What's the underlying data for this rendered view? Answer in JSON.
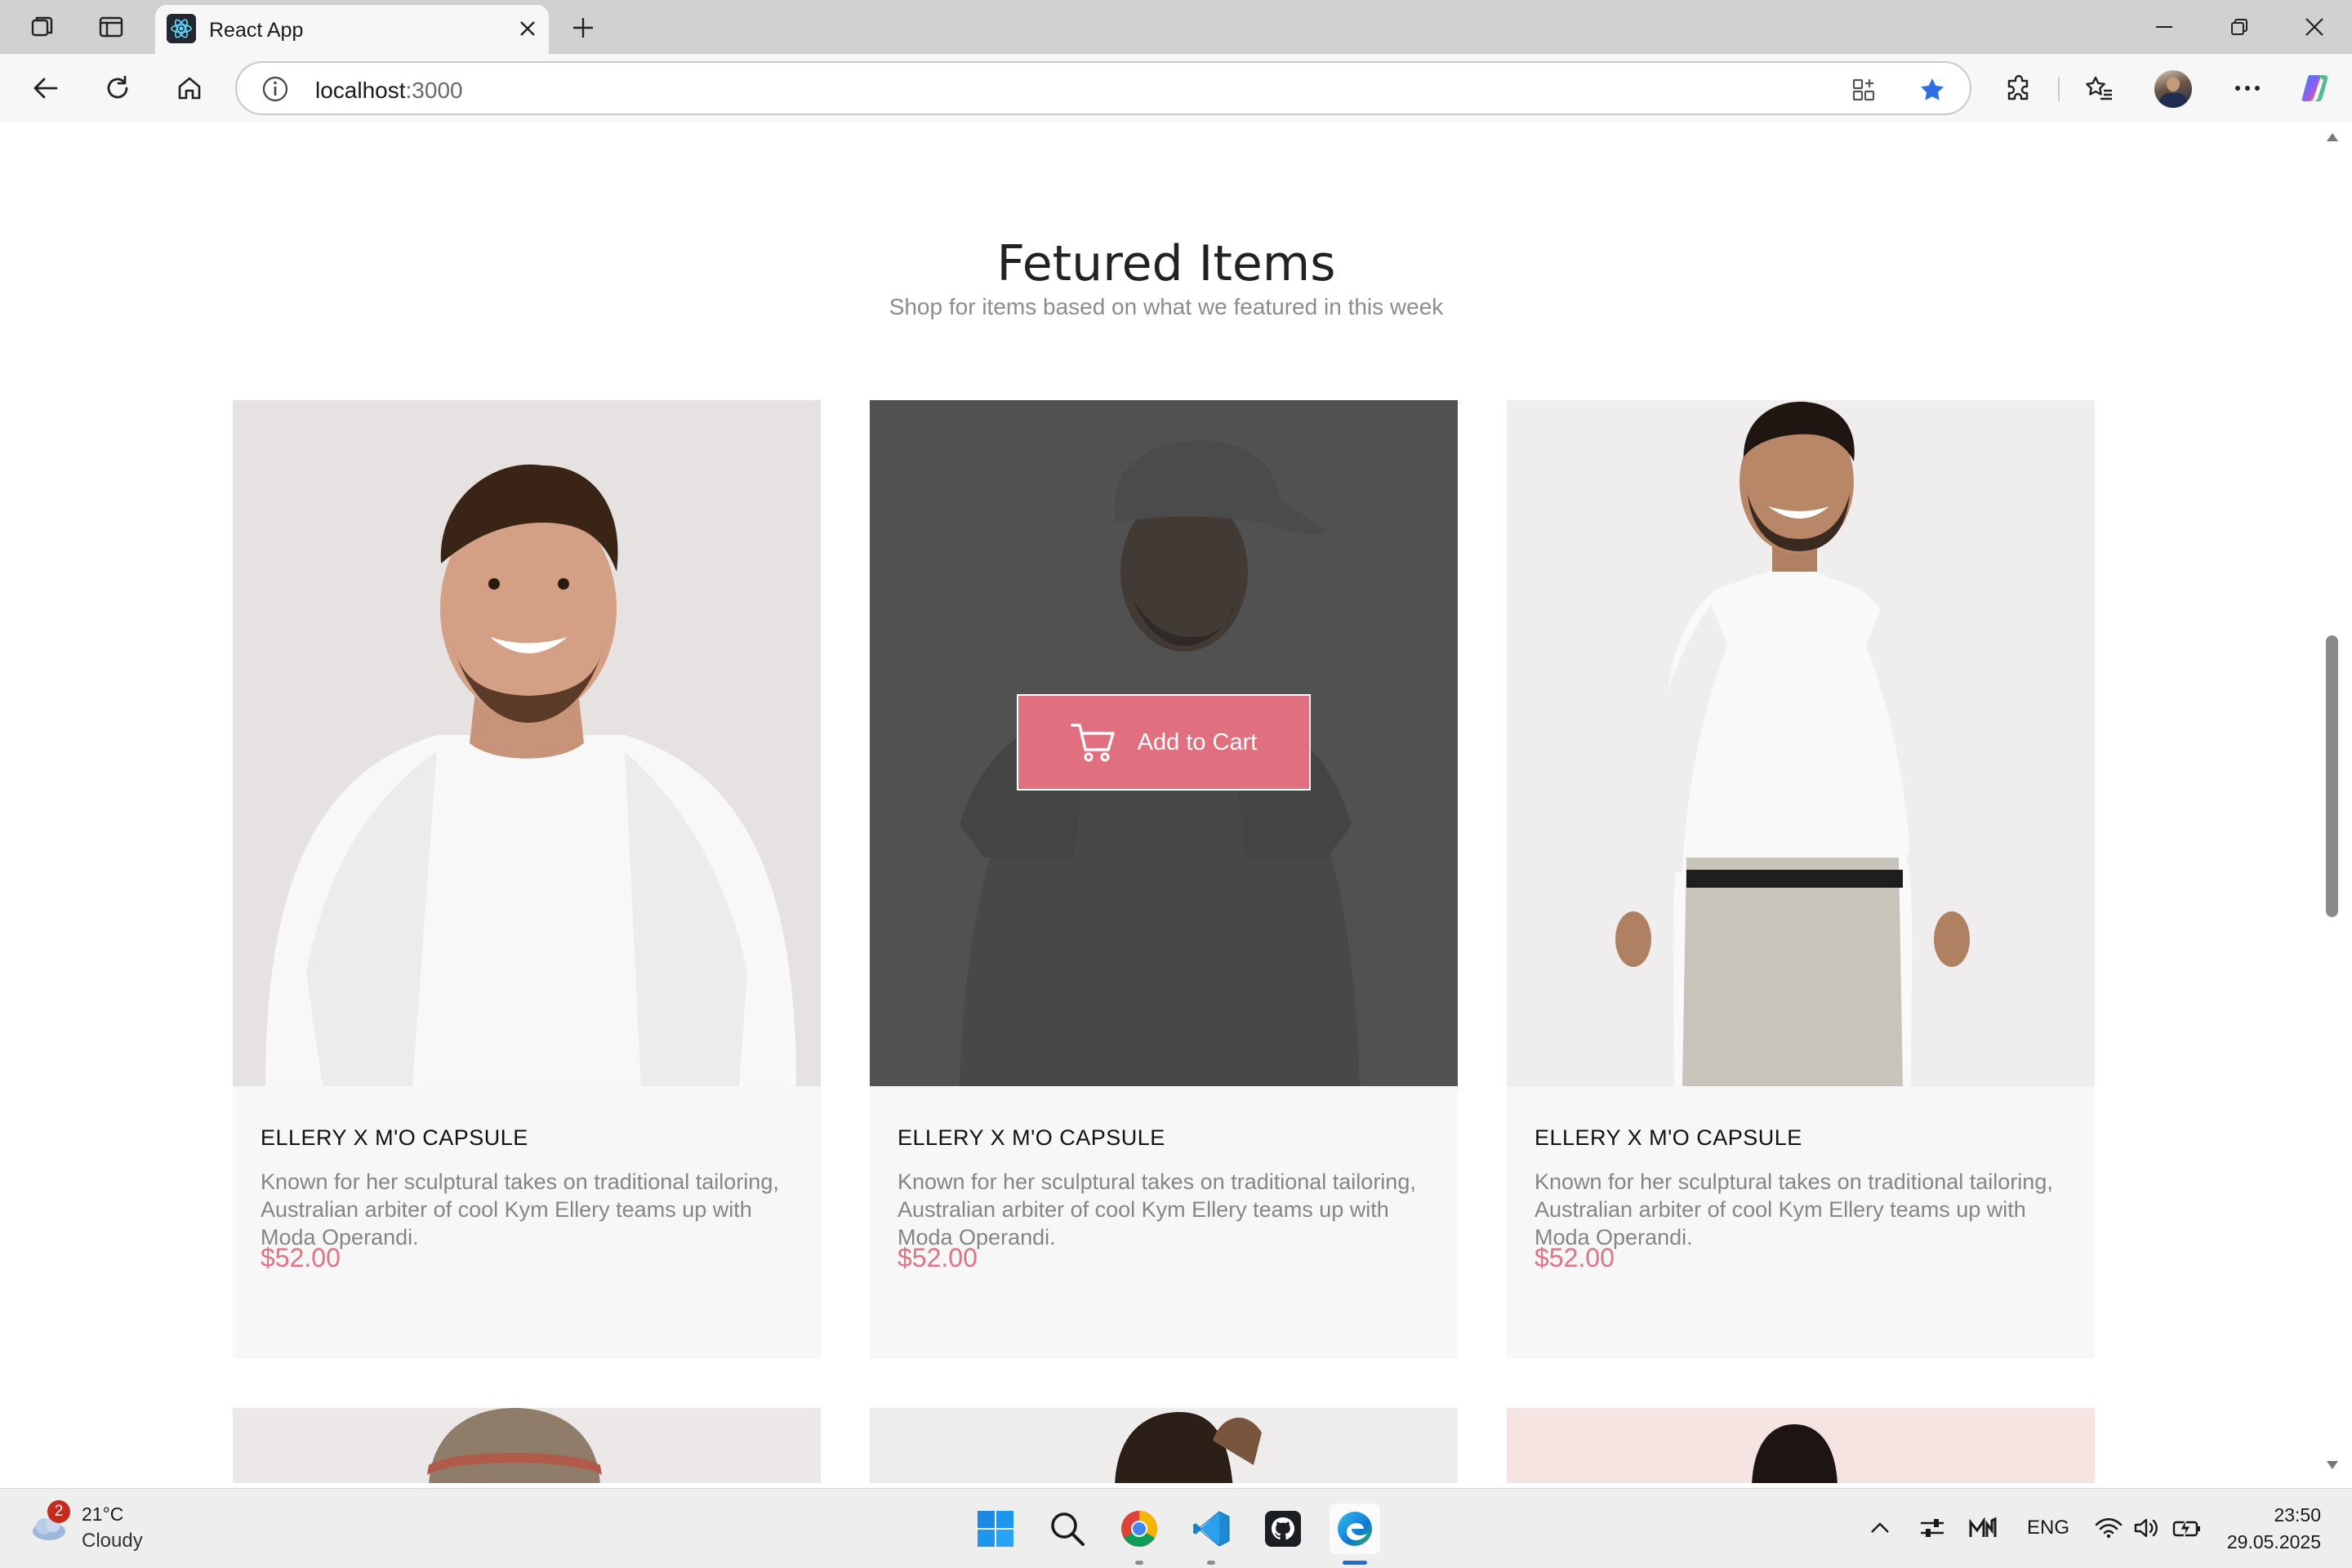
{
  "browser": {
    "tab_title": "React App",
    "url_host": "localhost",
    "url_port": ":3000",
    "icons": [
      "workspaces-icon",
      "tab-actions-icon",
      "react-favicon",
      "close-tab-icon",
      "new-tab-icon",
      "minimize-icon",
      "restore-icon",
      "close-window-icon",
      "back-icon",
      "refresh-icon",
      "home-icon",
      "info-icon",
      "app-available-icon",
      "favorite-star-icon",
      "extensions-icon",
      "favorites-icon",
      "profile-avatar",
      "more-icon",
      "copilot-icon"
    ]
  },
  "page": {
    "title": "Fetured Items",
    "subtitle": "Shop for items based on what we featured in this week",
    "cards": [
      {
        "name": "ELLERY X M'O CAPSULE",
        "desc": "Known for her sculptural takes on traditional tailoring, Australian arbiter of cool Kym Ellery teams up with Moda Operandi.",
        "price": "$52.00",
        "bg": "#e6e2e2"
      },
      {
        "name": "ELLERY X M'O CAPSULE",
        "desc": "Known for her sculptural takes on traditional tailoring, Australian arbiter of cool Kym Ellery teams up with Moda Operandi.",
        "price": "$52.00",
        "bg": "#4e4e4e"
      },
      {
        "name": "ELLERY X M'O CAPSULE",
        "desc": "Known for her sculptural takes on traditional tailoring, Australian arbiter of cool Kym Ellery teams up with Moda Operandi.",
        "price": "$52.00",
        "bg": "#efeded"
      }
    ],
    "add_to_cart_label": "Add to Cart",
    "accent": "#e0707f",
    "price_color": "#e07283"
  },
  "taskbar": {
    "weather_badge": "2",
    "weather_temp": "21°C",
    "weather_cond": "Cloudy",
    "language": "ENG",
    "time": "23:50",
    "date": "29.05.2025",
    "apps": [
      "windows-start-icon",
      "search-icon",
      "chrome-icon",
      "vscode-icon",
      "github-desktop-icon",
      "edge-icon"
    ]
  }
}
